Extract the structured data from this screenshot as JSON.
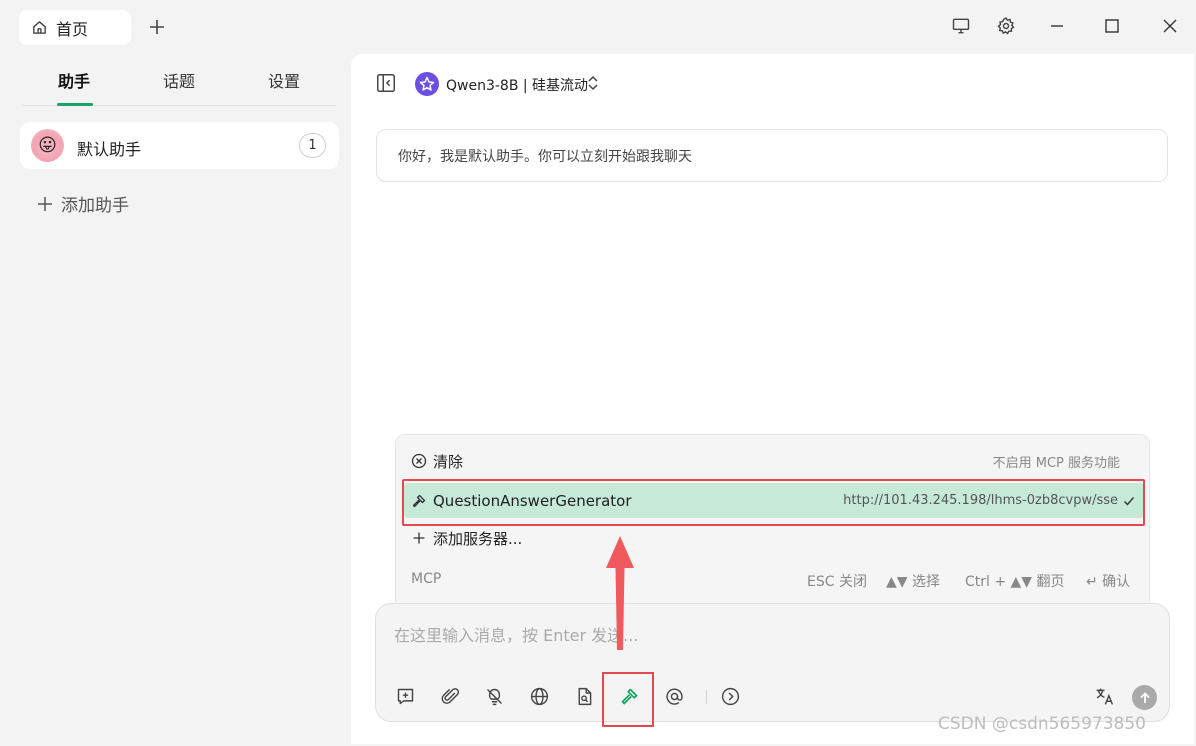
{
  "titlebar": {
    "tab_label": "首页",
    "icons": [
      "home-icon",
      "plus-icon",
      "monitor-icon",
      "gear-icon",
      "minimize-icon",
      "maximize-icon",
      "close-icon"
    ]
  },
  "sidebar": {
    "tabs": [
      {
        "label": "助手",
        "active": true
      },
      {
        "label": "话题",
        "active": false
      },
      {
        "label": "设置",
        "active": false
      }
    ],
    "assistants": [
      {
        "name": "默认助手",
        "count": "1",
        "avatar": "😛"
      }
    ],
    "add_assistant_label": "添加助手"
  },
  "main": {
    "model_name": "Qwen3-8B | 硅基流动",
    "greeting": "你好，我是默认助手。你可以立刻开始跟我聊天"
  },
  "mcp_menu": {
    "items": [
      {
        "label": "清除",
        "note": "不启用 MCP 服务功能",
        "icon": "x-circle-icon"
      },
      {
        "label": "QuestionAnswerGenerator",
        "note": "http://101.43.245.198/lhms-0zb8cvpw/sse",
        "icon": "hammer-icon",
        "selected": true
      },
      {
        "label": "添加服务器...",
        "icon": "plus-icon"
      }
    ],
    "footer": {
      "section": "MCP",
      "hints": [
        "ESC 关闭",
        "▲▼ 选择",
        "Ctrl + ▲▼ 翻页",
        "↵ 确认"
      ]
    }
  },
  "input": {
    "placeholder": "在这里输入消息，按 Enter 发送...",
    "value": "",
    "tools": [
      "new-topic-icon",
      "attachment-icon",
      "thinking-icon",
      "web-search-icon",
      "knowledge-icon",
      "mcp-hammer-icon",
      "mention-icon",
      "more-icon",
      "translate-icon",
      "send-icon"
    ]
  },
  "colors": {
    "accent": "#1aa267",
    "selected_row": "#c6e9d8",
    "annotation_red": "#e5484d"
  },
  "watermark": "CSDN @csdn565973850"
}
